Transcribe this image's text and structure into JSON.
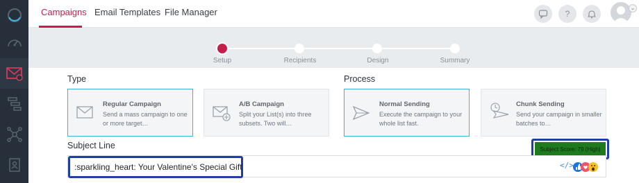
{
  "header": {
    "tabs": [
      {
        "label": "Campaigns",
        "active": true
      },
      {
        "label": "Email Templates",
        "active": false
      },
      {
        "label": "File Manager",
        "active": false
      }
    ],
    "help_label": "?"
  },
  "sidebar": {
    "items": [
      {
        "icon": "logo-ring-icon"
      },
      {
        "icon": "dashboard-gauge-icon"
      },
      {
        "icon": "campaign-mail-icon",
        "active": true
      },
      {
        "icon": "hierarchy-icon"
      },
      {
        "icon": "network-icon"
      },
      {
        "icon": "contacts-book-icon"
      }
    ]
  },
  "stepper": {
    "steps": [
      {
        "label": "Setup",
        "current": true
      },
      {
        "label": "Recipients",
        "current": false
      },
      {
        "label": "Design",
        "current": false
      },
      {
        "label": "Summary",
        "current": false
      }
    ]
  },
  "type_section": {
    "title": "Type",
    "cards": [
      {
        "title": "Regular Campaign",
        "desc": "Send a mass campaign to one or more target…",
        "selected": true
      },
      {
        "title": "A/B Campaign",
        "desc": "Split your List(s) into three subsets. Two will…",
        "selected": false
      }
    ]
  },
  "process_section": {
    "title": "Process",
    "cards": [
      {
        "title": "Normal Sending",
        "desc": "Execute the campaign to your whole list fast.",
        "selected": true
      },
      {
        "title": "Chunk Sending",
        "desc": "Send your campaign in smaller batches to…",
        "selected": false
      }
    ]
  },
  "subject": {
    "label": "Subject Line",
    "value": ":sparkling_heart: Your Valentine's Special Gift",
    "score_text": "Subject Score: 79 (High)",
    "code_icon_text": "</>"
  },
  "colors": {
    "accent": "#c41f4a",
    "selected_border": "#33b3e0",
    "highlight_box": "#1f3fa6",
    "score_bg": "#1d7a1d"
  }
}
